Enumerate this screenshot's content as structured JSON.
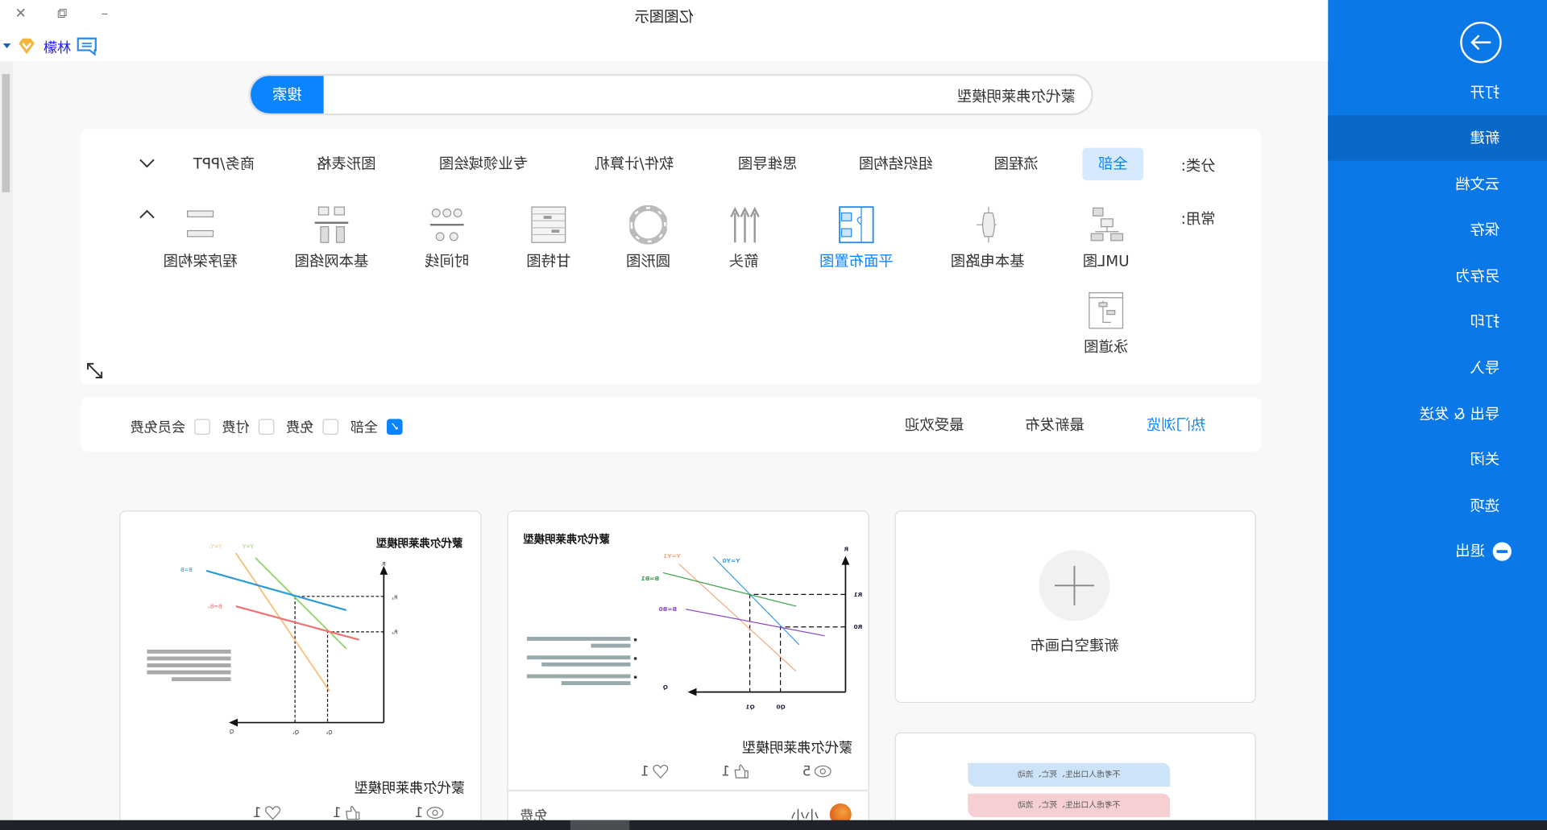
{
  "app": {
    "title": "亿图图示",
    "user_name": "檬林"
  },
  "window_controls": {
    "minimize": "–",
    "restore": "⧉",
    "close": "✕"
  },
  "sidebar": {
    "accent": "#0b78e8",
    "items": [
      {
        "label": "打开"
      },
      {
        "label": "新建",
        "active": true
      },
      {
        "label": "云文档"
      },
      {
        "label": "保存"
      },
      {
        "label": "另存为"
      },
      {
        "label": "打印"
      },
      {
        "label": "导入"
      },
      {
        "label": "导出 & 发送"
      },
      {
        "label": "关闭"
      },
      {
        "label": "选项"
      },
      {
        "label": "退出"
      }
    ]
  },
  "search": {
    "value": "蒙代尔弗莱明模型",
    "button_label": "搜索"
  },
  "categories": {
    "label": "分类:",
    "items": [
      "全部",
      "流程图",
      "组织结构图",
      "思维导图",
      "软件/计算机",
      "专业领域绘图",
      "图形表格",
      "商务/PPT"
    ],
    "selected": "全部"
  },
  "common": {
    "label": "常用:",
    "items": [
      "UML图",
      "基本电路图",
      "平面布置图",
      "箭头",
      "圆形图",
      "甘特图",
      "时间线",
      "基本网络图",
      "程序架构图",
      "泳道图"
    ],
    "highlighted": "平面布置图"
  },
  "sort_tabs": {
    "items": [
      "热门浏览",
      "最新发布",
      "最受欢迎"
    ],
    "active": "热门浏览"
  },
  "price_filters": [
    {
      "label": "全部",
      "checked": true
    },
    {
      "label": "免费",
      "checked": false
    },
    {
      "label": "付费",
      "checked": false
    },
    {
      "label": "会员免费",
      "checked": false
    }
  ],
  "blank_card": {
    "label": "新建空白画布"
  },
  "templates": [
    {
      "title": "蒙代尔弗莱明模型",
      "thumb_title": "蒙代尔弗莱明模型",
      "views": "5",
      "likes": "1",
      "favorites": "1",
      "author": "小小",
      "price": "免费",
      "chart_labels": {
        "r": "R",
        "r1": "R1",
        "r0": "R0",
        "q": "Q",
        "q1": "Q1",
        "q0": "Q0",
        "y0": "Y=Y0",
        "y1": "Y=Y1",
        "b1": "B=B1",
        "b0": "B=B0"
      }
    },
    {
      "title": "蒙代尔弗莱明模型",
      "thumb_title": "蒙代尔弗莱明模型",
      "views": "1",
      "likes": "1",
      "favorites": "1",
      "chart_labels": {
        "r": "R",
        "r1": "R₁",
        "r2": "R₂",
        "q": "Q",
        "q1": "Q₁",
        "q2": "Q₂",
        "y": "Y=Y",
        "y1": "Y=Y₁",
        "b": "B=B",
        "b2": "B=B₂"
      }
    }
  ],
  "partial_card": {
    "rows": [
      "不考虑人口出生、死亡、流动",
      "不考虑人口出生、死亡、流动"
    ],
    "colors": [
      "#cce3f8",
      "#f5cfd1"
    ]
  }
}
